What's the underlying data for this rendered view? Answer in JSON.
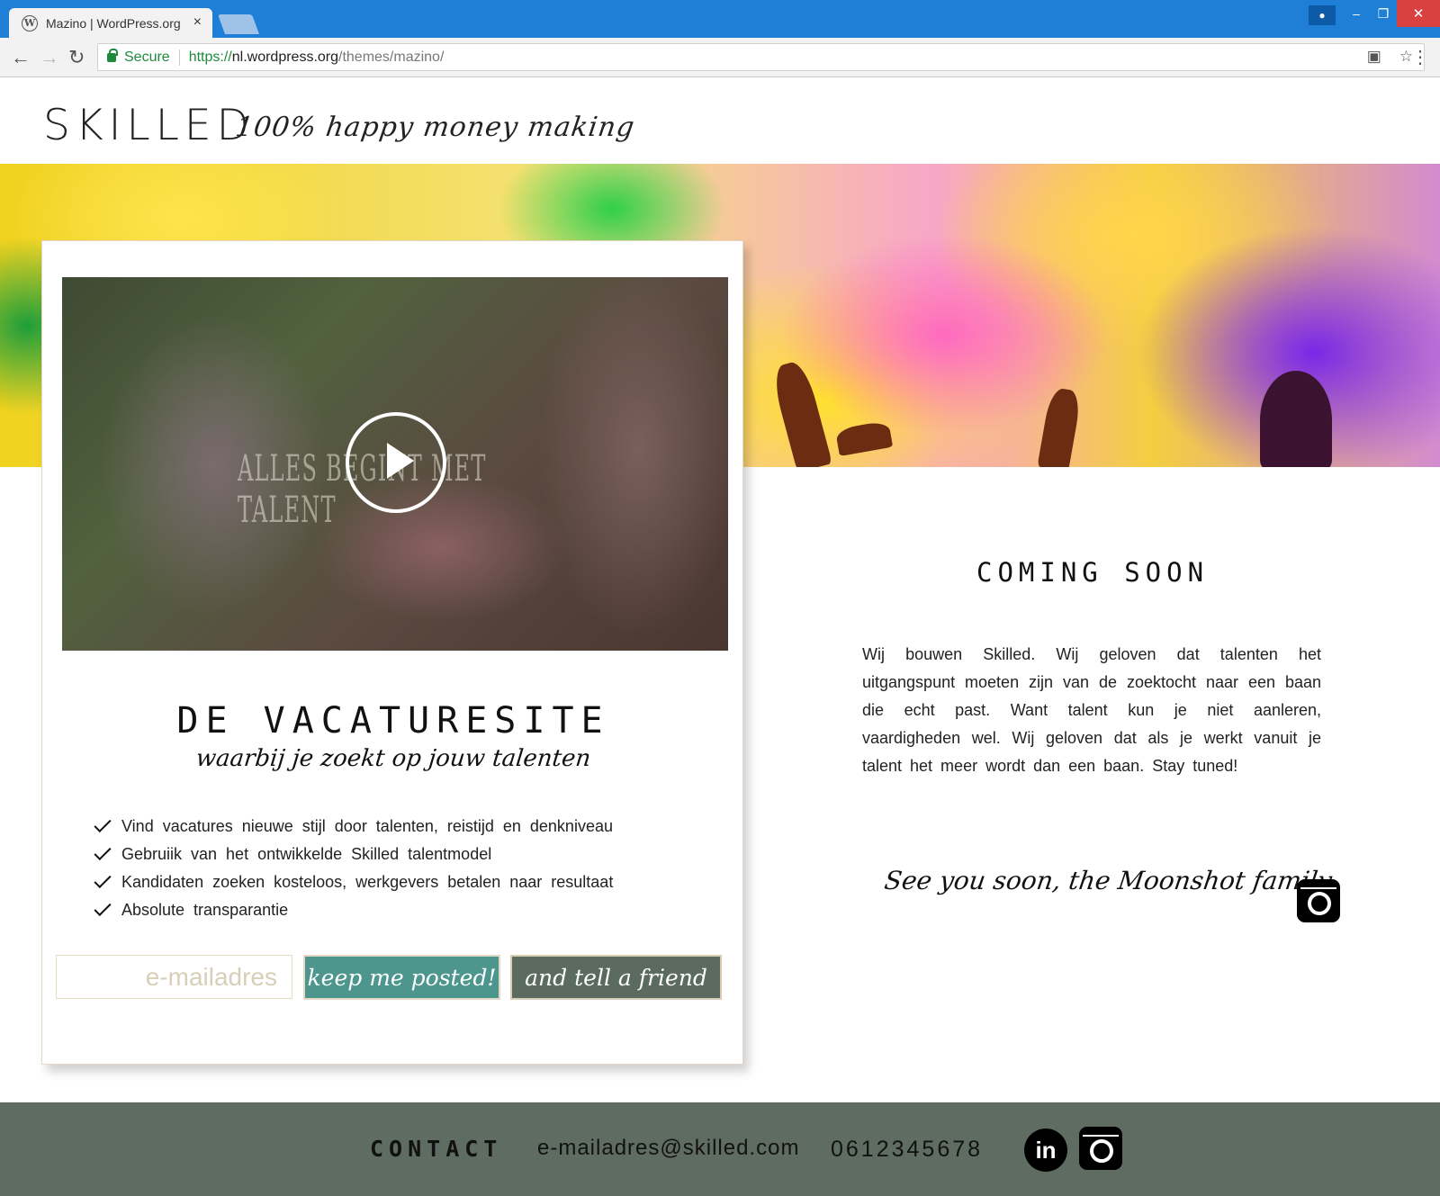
{
  "browser": {
    "tab_title": "Mazino | WordPress.org",
    "tab_close": "×",
    "secure_label": "Secure",
    "url_scheme": "https://",
    "url_host": "nl.wordpress.org",
    "url_path": "/themes/mazino/",
    "icons": [
      "wordpress-icon",
      "back-icon",
      "forward-icon",
      "reload-icon",
      "lock-icon",
      "translate-icon",
      "bookmark-star-icon",
      "menu-icon",
      "user-icon",
      "minimize-icon",
      "restore-icon",
      "close-icon"
    ]
  },
  "header": {
    "logo": "SKILLED",
    "tagline": "100% happy money making"
  },
  "video": {
    "overlay_text": "ALLES BEGINT MET TALENT"
  },
  "card": {
    "title": "DE VACATURESITE",
    "subtitle": "waarbij je zoekt op jouw talenten",
    "features": [
      "Vind vacatures nieuwe stijl door talenten, reistijd en denkniveau",
      "Gebruiik van het ontwikkelde Skilled talentmodel",
      "Kandidaten zoeken kosteloos, werkgevers betalen naar resultaat",
      "Absolute transparantie"
    ],
    "email_placeholder": "e-mailadres",
    "keep_posted_label": "keep me posted!",
    "tell_friend_label": "and tell a friend"
  },
  "right": {
    "coming_soon": "COMING SOON",
    "about": "Wij bouwen Skilled. Wij geloven dat talenten het uitgangspunt moeten zijn van de zoektocht naar een baan die echt past. Want talent kun je niet aanleren, vaardigheden wel. Wij geloven dat als je werkt vanuit je talent het meer wordt dan een baan. Stay tuned!",
    "signoff": "See you soon, the Moonshot family"
  },
  "footer": {
    "contact_label": "CONTACT",
    "email": "e-mailadres@skilled.com",
    "phone": "0612345678",
    "linkedin_glyph": "in"
  },
  "colors": {
    "chrome_blue": "#1f7fd6",
    "keep_button": "#4d968d",
    "tell_button": "#5b6b5f",
    "footer_bg": "#5e6c62"
  }
}
